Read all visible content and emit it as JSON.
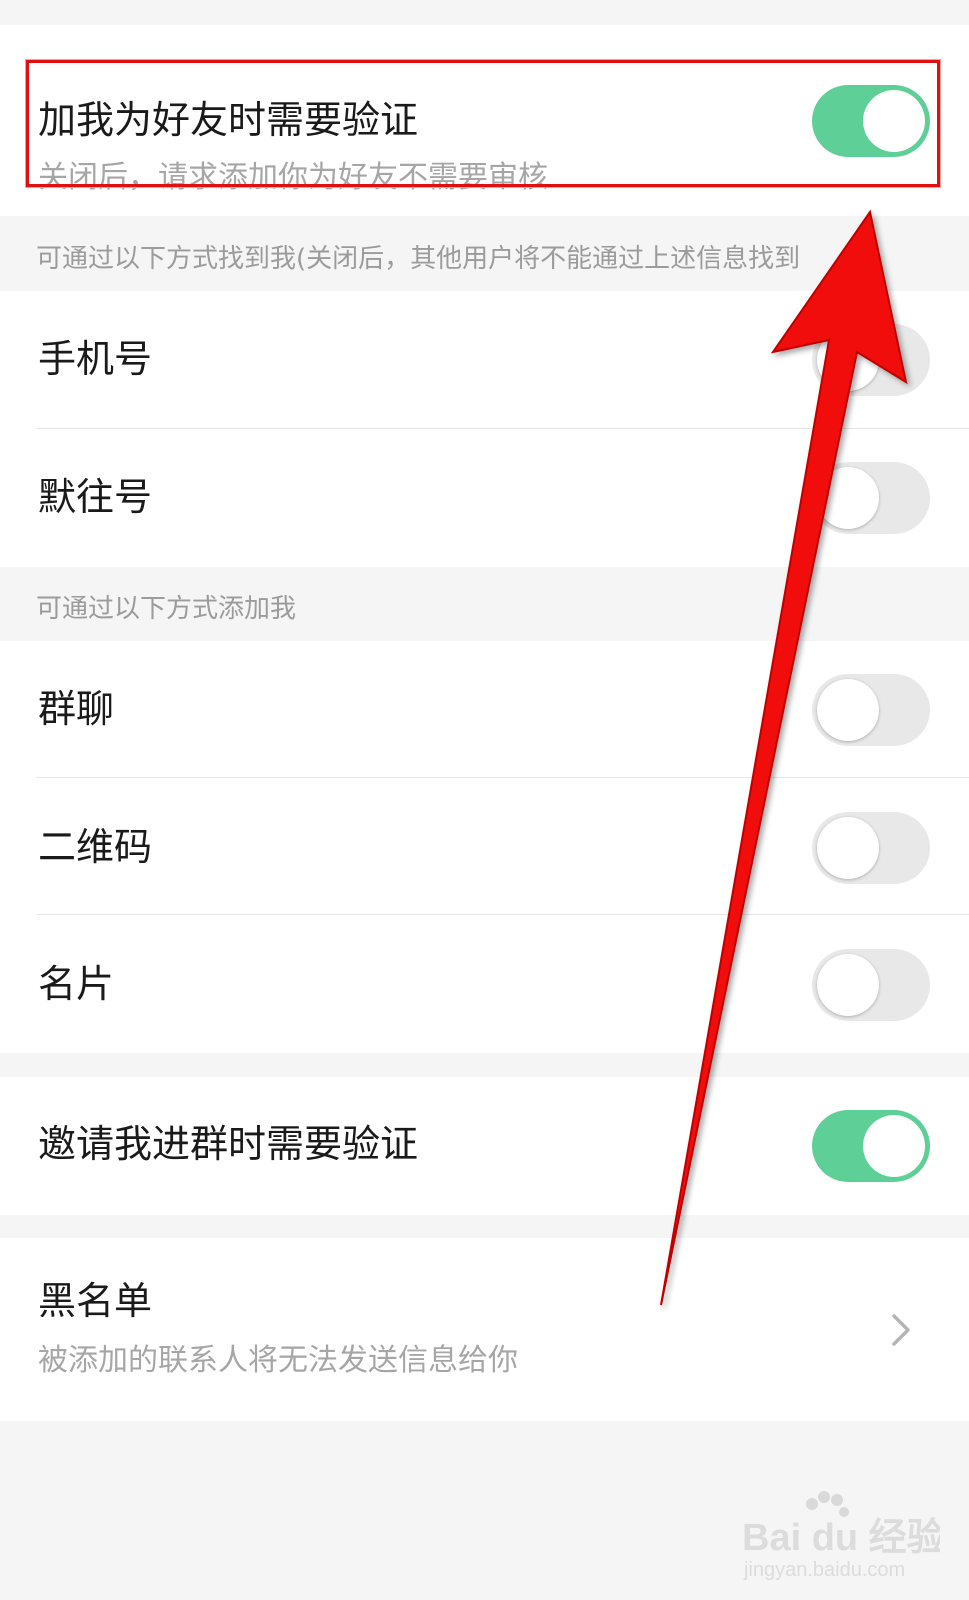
{
  "verify_on_add": {
    "title": "加我为好友时需要验证",
    "subtitle": "关闭后，请求添加你为好友不需要审核",
    "toggle_on": true
  },
  "find_me_section": {
    "label": "可通过以下方式找到我(关闭后，其他用户将不能通过上述信息找到",
    "items": [
      {
        "title": "手机号",
        "toggle_on": false
      },
      {
        "title": "默往号",
        "toggle_on": false
      }
    ]
  },
  "add_me_section": {
    "label": "可通过以下方式添加我",
    "items": [
      {
        "title": "群聊",
        "toggle_on": false
      },
      {
        "title": "二维码",
        "toggle_on": false
      },
      {
        "title": "名片",
        "toggle_on": false
      }
    ]
  },
  "group_invite_verify": {
    "title": "邀请我进群时需要验证",
    "toggle_on": true
  },
  "blacklist": {
    "title": "黑名单",
    "subtitle": "被添加的联系人将无法发送信息给你",
    "icon": "chevron-right-icon"
  },
  "watermark": {
    "logo_text": "Bai du 经验",
    "url": "jingyan.baidu.com"
  },
  "colors": {
    "toggle_on": "#5ed097",
    "toggle_off": "#e8e8e8",
    "annotation": "#e01010"
  }
}
